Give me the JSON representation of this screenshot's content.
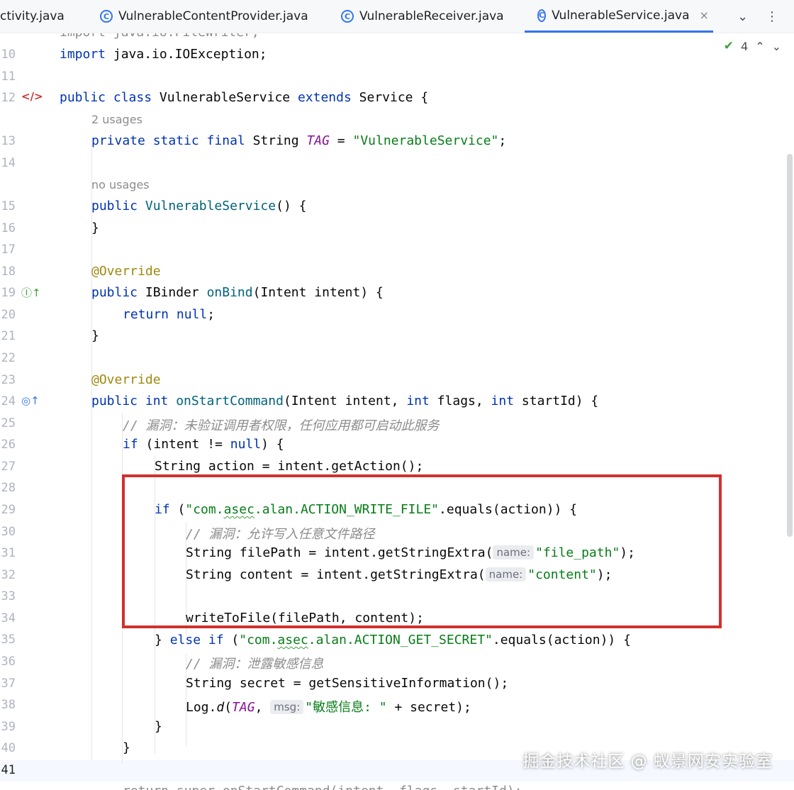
{
  "tabs": [
    {
      "label": "ctivity.java",
      "icon": "none",
      "active": false
    },
    {
      "label": "VulnerableContentProvider.java",
      "icon": "class-icon",
      "active": false
    },
    {
      "label": "VulnerableReceiver.java",
      "icon": "class-icon",
      "active": false
    },
    {
      "label": "VulnerableService.java",
      "icon": "class-icon",
      "active": true
    }
  ],
  "tab_close": "×",
  "tab_menu": {
    "dropdown": "⌄",
    "more": "⋮"
  },
  "inspection": {
    "count": "4"
  },
  "hints": {
    "usages2": "2 usages",
    "nousages": "no usages"
  },
  "code": {
    "l9": "import java.io.FileWriter;",
    "l10_kw": "import",
    "l10_rest": " java.io.IOException;",
    "l12_kw": "public class",
    "l12_name": " VulnerableService ",
    "l12_ext": "extends",
    "l12_rest": " Service {",
    "l13_kw": "private static final",
    "l13_type": " String ",
    "l13_tag": "TAG",
    "l13_eq": " = ",
    "l13_str": "\"VulnerableService\"",
    "l13_end": ";",
    "l15_kw": "public",
    "l15_fn": " VulnerableService",
    "l15_rest": "() {",
    "l16": "}",
    "l18": "@Override",
    "l19_kw": "public",
    "l19_type": " IBinder ",
    "l19_fn": "onBind",
    "l19_rest": "(Intent intent) {",
    "l20_kw": "return",
    "l20_null": " null",
    "l20_end": ";",
    "l21": "}",
    "l23": "@Override",
    "l24_kw": "public int",
    "l24_fn": " onStartCommand",
    "l24_a": "(Intent intent, ",
    "l24_int1": "int",
    "l24_b": " flags, ",
    "l24_int2": "int",
    "l24_c": " startId) {",
    "l25": "// 漏洞：未验证调用者权限，任何应用都可启动此服务",
    "l26_kw": "if",
    "l26_a": " (intent != ",
    "l26_null": "null",
    "l26_b": ") {",
    "l27": "String action = intent.getAction();",
    "l29_kw": "if",
    "l29_a": " (",
    "l29_s1": "\"com.",
    "l29_s2": "asec",
    "l29_s3": ".alan.ACTION_WRITE_FILE\"",
    "l29_b": ".equals(action)) {",
    "l30": "// 漏洞：允许写入任意文件路径",
    "l31_a": "String filePath = intent.getStringExtra(",
    "l31_p": "name:",
    "l31_s": "\"file_path\"",
    "l31_b": ");",
    "l32_a": "String content = intent.getStringExtra(",
    "l32_p": "name:",
    "l32_s": "\"content\"",
    "l32_b": ");",
    "l34": "writeToFile(filePath, content);",
    "l35_a": "} ",
    "l35_kw": "else if",
    "l35_b": " (",
    "l35_s1": "\"com.",
    "l35_s2": "asec",
    "l35_s3": ".alan.ACTION_GET_SECRET\"",
    "l35_c": ".equals(action)) {",
    "l36": "// 漏洞：泄露敏感信息",
    "l37": "String secret = getSensitiveInformation();",
    "l38_a": "Log.",
    "l38_d": "d",
    "l38_b": "(",
    "l38_tag": "TAG",
    "l38_c": ", ",
    "l38_p": "msg:",
    "l38_s": "\"敏感信息: \"",
    "l38_e": " + secret);",
    "l39": "}",
    "l40": "}",
    "l42": "return super.onStartCommand(intent, flags, startId);"
  },
  "line_numbers": [
    "10",
    "11",
    "12",
    "13",
    "14",
    "15",
    "16",
    "17",
    "18",
    "19",
    "20",
    "21",
    "22",
    "23",
    "24",
    "25",
    "26",
    "27",
    "28",
    "29",
    "30",
    "31",
    "32",
    "33",
    "34",
    "35",
    "36",
    "37",
    "38",
    "39",
    "40",
    "41"
  ],
  "watermark": "掘金技术社区 @ 蚁景网安实验室",
  "colors": {
    "keyword": "#0033b3",
    "string": "#067d17",
    "annotation": "#9e880d",
    "highlight_box": "#d0312d",
    "tab_accent": "#3574f0"
  }
}
